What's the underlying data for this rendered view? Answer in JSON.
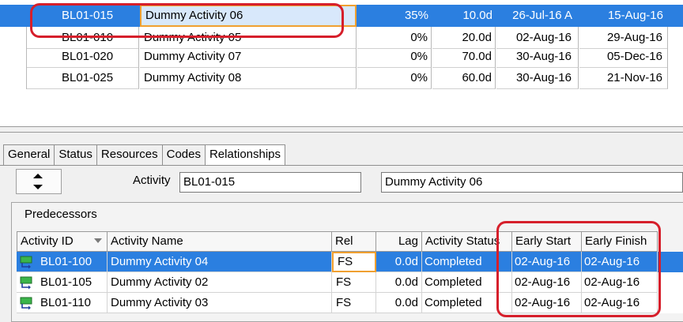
{
  "top_grid": {
    "rows": [
      {
        "id": "BL01-015",
        "name": "Dummy Activity 06",
        "pct": "35%",
        "duration": "10.0d",
        "start": "26-Jul-16 A",
        "finish": "15-Aug-16",
        "selected": true
      },
      {
        "id": "BL01-010",
        "name": "Dummy Activity 05",
        "pct": "0%",
        "duration": "20.0d",
        "start": "02-Aug-16",
        "finish": "29-Aug-16",
        "selected": false
      },
      {
        "id": "BL01-020",
        "name": "Dummy Activity 07",
        "pct": "0%",
        "duration": "70.0d",
        "start": "30-Aug-16",
        "finish": "05-Dec-16",
        "selected": false
      },
      {
        "id": "BL01-025",
        "name": "Dummy Activity 08",
        "pct": "0%",
        "duration": "60.0d",
        "start": "30-Aug-16",
        "finish": "21-Nov-16",
        "selected": false
      }
    ]
  },
  "tabs": [
    "General",
    "Status",
    "Resources",
    "Codes",
    "Relationships"
  ],
  "active_tab": "Relationships",
  "activity": {
    "label": "Activity",
    "id": "BL01-015",
    "name": "Dummy Activity 06"
  },
  "predecessors": {
    "title": "Predecessors",
    "columns": [
      "Activity ID",
      "Activity Name",
      "Rel",
      "Lag",
      "Activity Status",
      "Early Start",
      "Early Finish"
    ],
    "rows": [
      {
        "id": "BL01-100",
        "name": "Dummy Activity 04",
        "rel": "FS",
        "lag": "0.0d",
        "status": "Completed",
        "early_start": "02-Aug-16",
        "early_finish": "02-Aug-16",
        "selected": true
      },
      {
        "id": "BL01-105",
        "name": "Dummy Activity 02",
        "rel": "FS",
        "lag": "0.0d",
        "status": "Completed",
        "early_start": "02-Aug-16",
        "early_finish": "02-Aug-16",
        "selected": false
      },
      {
        "id": "BL01-110",
        "name": "Dummy Activity 03",
        "rel": "FS",
        "lag": "0.0d",
        "status": "Completed",
        "early_start": "02-Aug-16",
        "early_finish": "02-Aug-16",
        "selected": false
      }
    ]
  },
  "colors": {
    "selection": "#2b7fe0",
    "highlight_annotation": "#d61f2b",
    "focus_border": "#f0a030",
    "task_icon": "#3bb54a"
  },
  "icons": {
    "task": "completed-task-icon",
    "sort": "sort-arrow-icon",
    "spinner_up": "arrow-up-icon",
    "spinner_down": "arrow-down-icon"
  }
}
